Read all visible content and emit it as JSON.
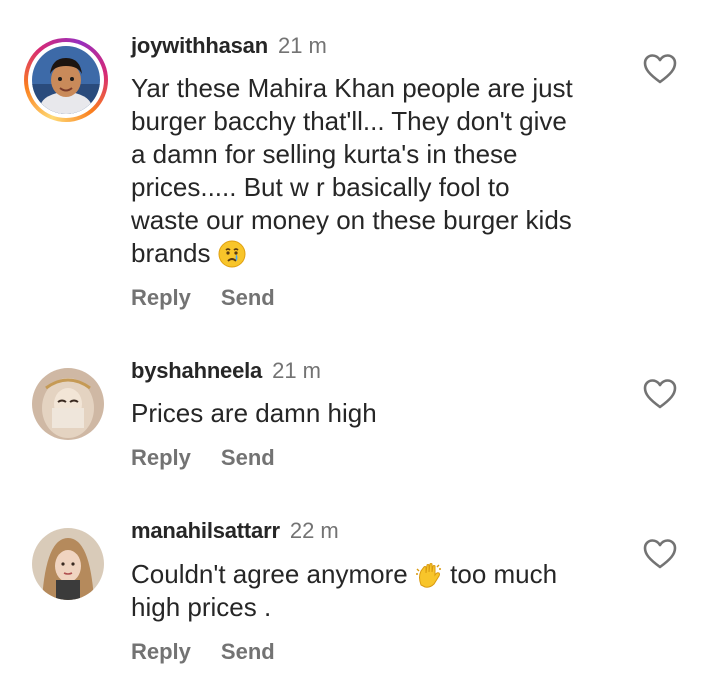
{
  "comments": [
    {
      "username": "joywithhasan",
      "time": "21 m",
      "text_lines": [
        "Yar these Mahira Khan people are just",
        "burger bacchy that'll... They don't give",
        "a damn for selling kurta's in these",
        "prices..... But w r basically fool to",
        "waste our money on these burger kids",
        "brands"
      ],
      "emoji": "crying-face",
      "reply_label": "Reply",
      "send_label": "Send",
      "has_story_ring": true
    },
    {
      "username": "byshahneela",
      "time": "21 m",
      "text_lines": [
        "Prices are damn high"
      ],
      "reply_label": "Reply",
      "send_label": "Send",
      "has_story_ring": false
    },
    {
      "username": "manahilsattarr",
      "time": "22 m",
      "text_before_emoji": "Couldn't agree anymore",
      "emoji": "waving-hands",
      "text_after_emoji": "too much",
      "text_line2": "high prices .",
      "reply_label": "Reply",
      "send_label": "Send",
      "has_story_ring": false
    }
  ],
  "icons": {
    "like": "heart-outline-icon"
  },
  "colors": {
    "text": "#262626",
    "secondary": "#737373",
    "background": "#ffffff"
  }
}
